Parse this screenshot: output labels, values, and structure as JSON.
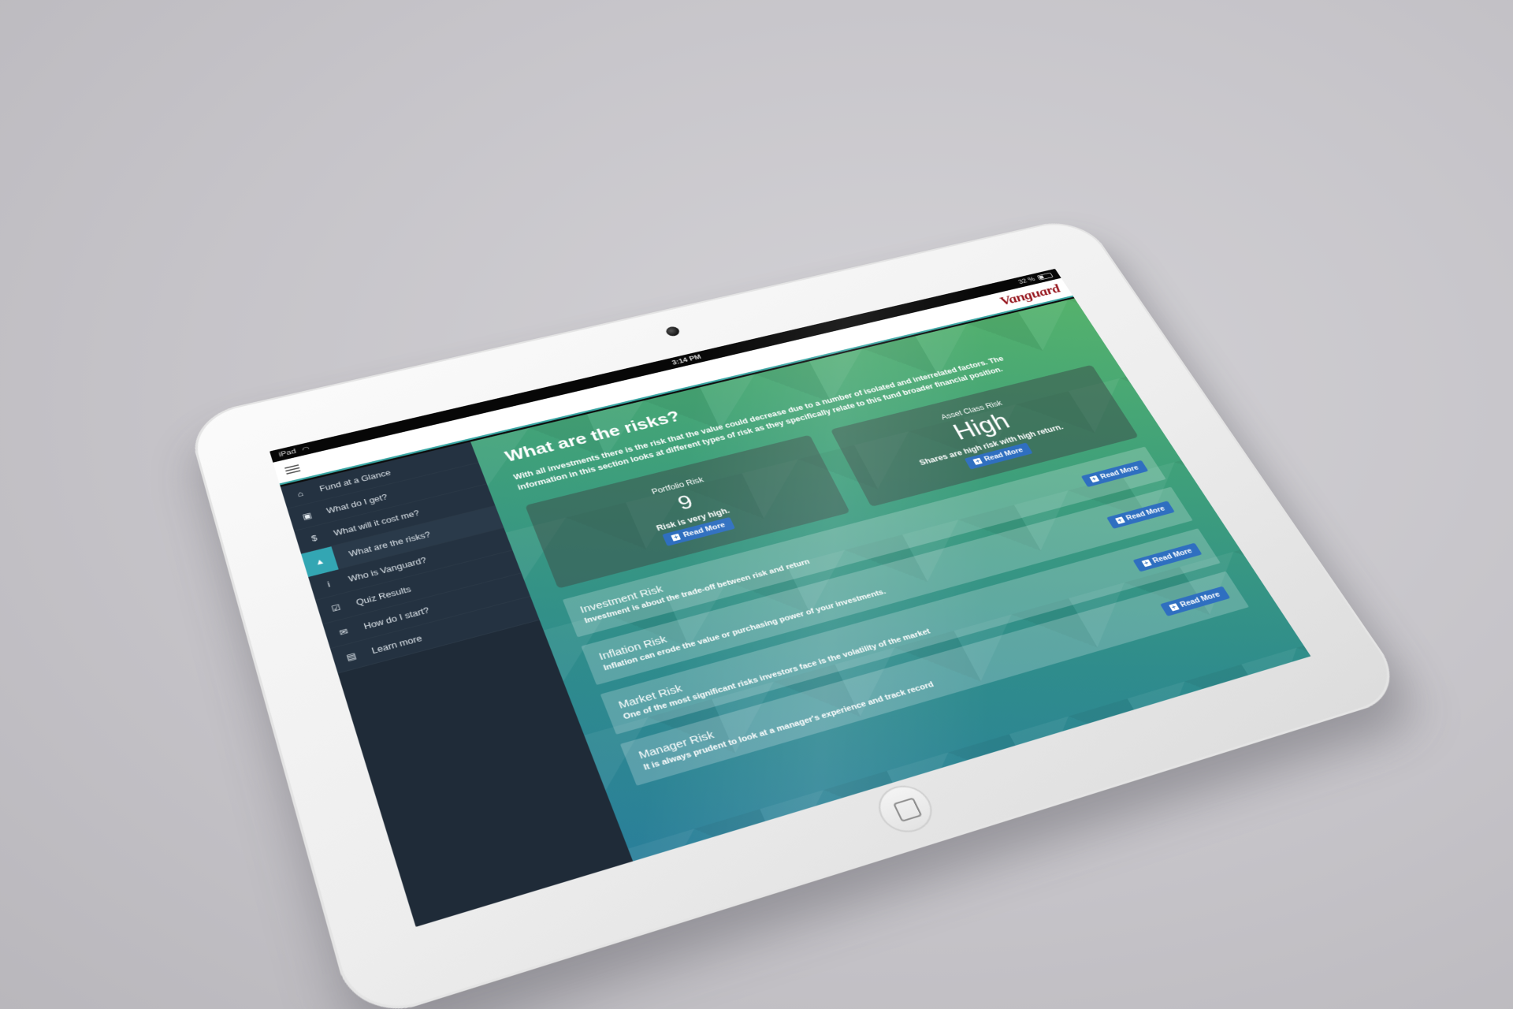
{
  "status_bar": {
    "device": "iPad",
    "time": "3:14 PM",
    "battery": "32 %"
  },
  "header": {
    "brand": "Vanguard"
  },
  "sidebar": {
    "items": [
      {
        "label": "Fund at a Glance",
        "icon": "home-icon",
        "glyph": "⌂"
      },
      {
        "label": "What do I get?",
        "icon": "briefcase-icon",
        "glyph": "▣"
      },
      {
        "label": "What will it cost me?",
        "icon": "dollar-icon",
        "glyph": "$"
      },
      {
        "label": "What are the risks?",
        "icon": "warning-icon",
        "glyph": "▲"
      },
      {
        "label": "Who is Vanguard?",
        "icon": "info-icon",
        "glyph": "i"
      },
      {
        "label": "Quiz Results",
        "icon": "checkbox-icon",
        "glyph": "☑"
      },
      {
        "label": "How do I start?",
        "icon": "comments-icon",
        "glyph": "✉"
      },
      {
        "label": "Learn more",
        "icon": "book-icon",
        "glyph": "▤"
      }
    ]
  },
  "main": {
    "title": "What are the risks?",
    "intro": "With all investments there is the risk that the value could decrease due to a number of isolated and interrelated factors. The information in this section looks at different types of risk as they specifically relate to this fund broader financial position.",
    "portfolio_risk": {
      "label": "Portfolio Risk",
      "value": "9",
      "description": "Risk is very high.",
      "button": "Read More"
    },
    "asset_class_risk": {
      "label": "Asset Class Risk",
      "value": "High",
      "description": "Shares are high risk with high return.",
      "button": "Read More"
    },
    "risks": [
      {
        "title": "Investment Risk",
        "text": "Investment is about the trade-off between risk and return",
        "button": "Read More"
      },
      {
        "title": "Inflation Risk",
        "text": "Inflation can erode the value or purchasing power of your investments.",
        "button": "Read More"
      },
      {
        "title": "Market Risk",
        "text": "One of the most significant risks investors face is the volatility of the market",
        "button": "Read More"
      },
      {
        "title": "Manager Risk",
        "text": "It is always prudent to look at a manager's experience and track record",
        "button": "Read More"
      }
    ]
  },
  "colors": {
    "brand": "#96151d",
    "sidebar_bg": "#1f2b38",
    "active_accent": "#33a6b3",
    "button_blue": "#2f6fc0",
    "gradient_top": "#55b26c",
    "gradient_bottom": "#2a7f9a"
  }
}
